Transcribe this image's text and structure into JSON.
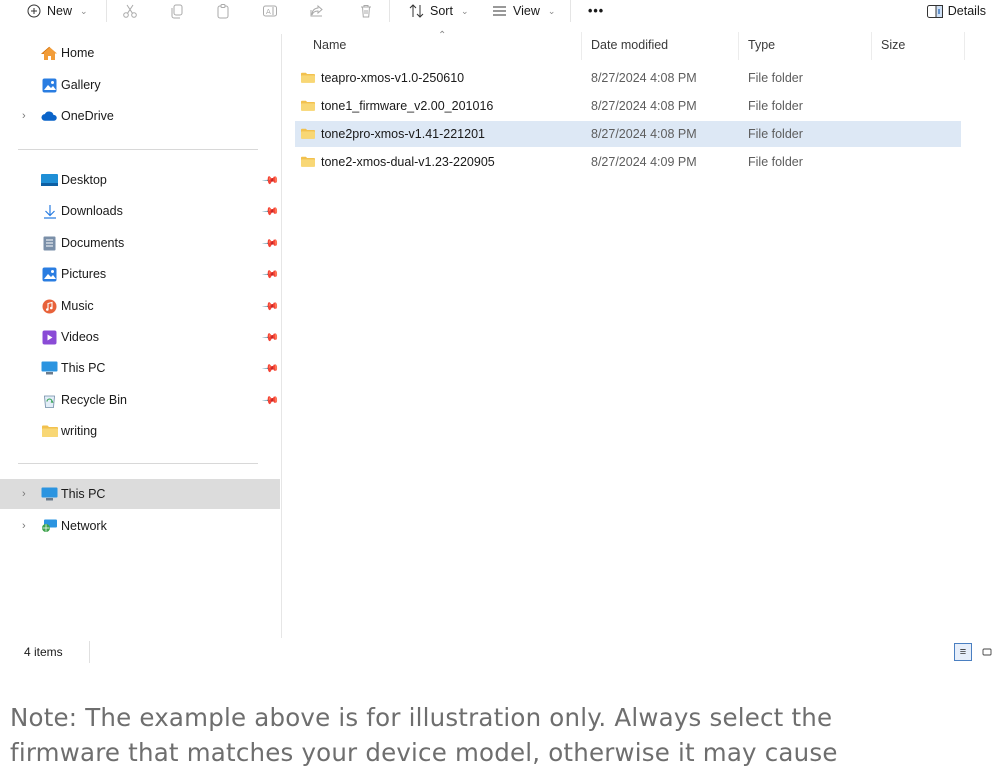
{
  "toolbar": {
    "new_label": "New",
    "sort_label": "Sort",
    "view_label": "View",
    "more_label": "•••",
    "details_label": "Details",
    "icons": [
      "cut-icon",
      "copy-icon",
      "paste-icon",
      "rename-icon",
      "share-icon",
      "delete-icon"
    ]
  },
  "sidebar": {
    "top": [
      {
        "label": "Home",
        "icon": "home-icon"
      },
      {
        "label": "Gallery",
        "icon": "gallery-icon"
      },
      {
        "label": "OneDrive",
        "icon": "onedrive-icon"
      }
    ],
    "quick_access": [
      {
        "label": "Desktop",
        "icon": "desktop-icon"
      },
      {
        "label": "Downloads",
        "icon": "download-icon"
      },
      {
        "label": "Documents",
        "icon": "documents-icon"
      },
      {
        "label": "Pictures",
        "icon": "pictures-icon"
      },
      {
        "label": "Music",
        "icon": "music-icon"
      },
      {
        "label": "Videos",
        "icon": "videos-icon"
      },
      {
        "label": "This PC",
        "icon": "computer-icon"
      },
      {
        "label": "Recycle Bin",
        "icon": "recycle-bin-icon"
      },
      {
        "label": "writing",
        "icon": "folder-icon"
      }
    ],
    "bottom": [
      {
        "label": "This PC",
        "icon": "computer-icon",
        "selected": true
      },
      {
        "label": "Network",
        "icon": "network-icon"
      }
    ]
  },
  "filelist": {
    "columns": {
      "name": "Name",
      "date": "Date modified",
      "type": "Type",
      "size": "Size"
    },
    "rows": [
      {
        "name": "teapro-xmos-v1.0-250610",
        "date": "8/27/2024 4:08 PM",
        "type": "File folder",
        "selected": false
      },
      {
        "name": "tone1_firmware_v2.00_201016",
        "date": "8/27/2024 4:08 PM",
        "type": "File folder",
        "selected": false
      },
      {
        "name": "tone2pro-xmos-v1.41-221201",
        "date": "8/27/2024 4:08 PM",
        "type": "File folder",
        "selected": true
      },
      {
        "name": "tone2-xmos-dual-v1.23-220905",
        "date": "8/27/2024 4:09 PM",
        "type": "File folder",
        "selected": false
      }
    ]
  },
  "status": {
    "item_count": "4 items"
  },
  "caption": {
    "line1": "Note: The example above is for illustration only. Always select the",
    "line2": "firmware that matches your device model, otherwise it may cause"
  },
  "colors": {
    "selection_row": "#dde8f5",
    "sidebar_selection": "#dcdcdc",
    "folder": "#f2c14e",
    "accent": "#0067c0"
  }
}
